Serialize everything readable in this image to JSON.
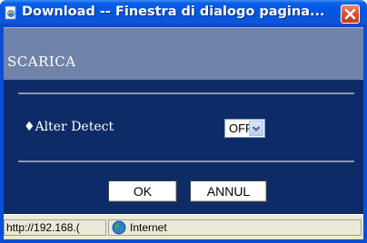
{
  "window": {
    "title": "Download -- Finestra di dialogo pagina...",
    "icon": "ie-page-icon",
    "close_icon": "close-icon"
  },
  "dialog": {
    "header": "SCARICA",
    "setting": {
      "marker": "♦",
      "label": "Alter Detect",
      "value": "OFF"
    },
    "buttons": {
      "ok": "OK",
      "cancel": "ANNUL"
    }
  },
  "statusbar": {
    "url": "http://192.168.(",
    "zone": "Internet",
    "zone_icon": "globe-icon"
  },
  "colors": {
    "titlebar": "#0054e3",
    "header_band": "#7083a8",
    "content_bg": "#0d2b66",
    "close_button": "#d9502c"
  }
}
